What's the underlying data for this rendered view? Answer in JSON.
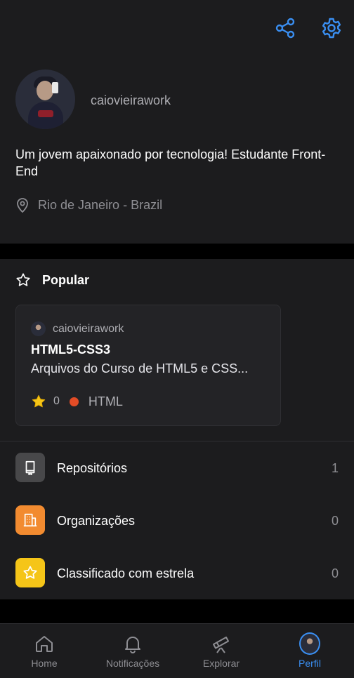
{
  "header": {
    "username": "caiovieirawork",
    "bio": "Um jovem apaixonado por tecnologia! Estudante Front-End",
    "location": "Rio de Janeiro - Brazil",
    "icons": {
      "share": "share-icon",
      "settings": "gear-icon",
      "location": "map-pin-icon"
    }
  },
  "popular": {
    "title": "Popular",
    "repo": {
      "owner": "caiovieirawork",
      "name": "HTML5-CSS3",
      "description": "Arquivos do Curso de HTML5 e CSS...",
      "stars": "0",
      "language": "HTML",
      "language_color": "#e34c26"
    }
  },
  "menu": {
    "items": [
      {
        "label": "Repositórios",
        "count": "1",
        "icon": "repo-icon",
        "color": "#48484a"
      },
      {
        "label": "Organizações",
        "count": "0",
        "icon": "organization-icon",
        "color": "#f28b30"
      },
      {
        "label": "Classificado com estrela",
        "count": "0",
        "icon": "star-icon",
        "color": "#f5c518"
      }
    ]
  },
  "nav": {
    "items": [
      {
        "label": "Home",
        "icon": "home-icon"
      },
      {
        "label": "Notificações",
        "icon": "bell-icon"
      },
      {
        "label": "Explorar",
        "icon": "telescope-icon"
      },
      {
        "label": "Perfil",
        "icon": "avatar",
        "active": true
      }
    ]
  },
  "colors": {
    "accent": "#3a8ff2",
    "background": "#1c1c1e",
    "divider": "#000000"
  }
}
